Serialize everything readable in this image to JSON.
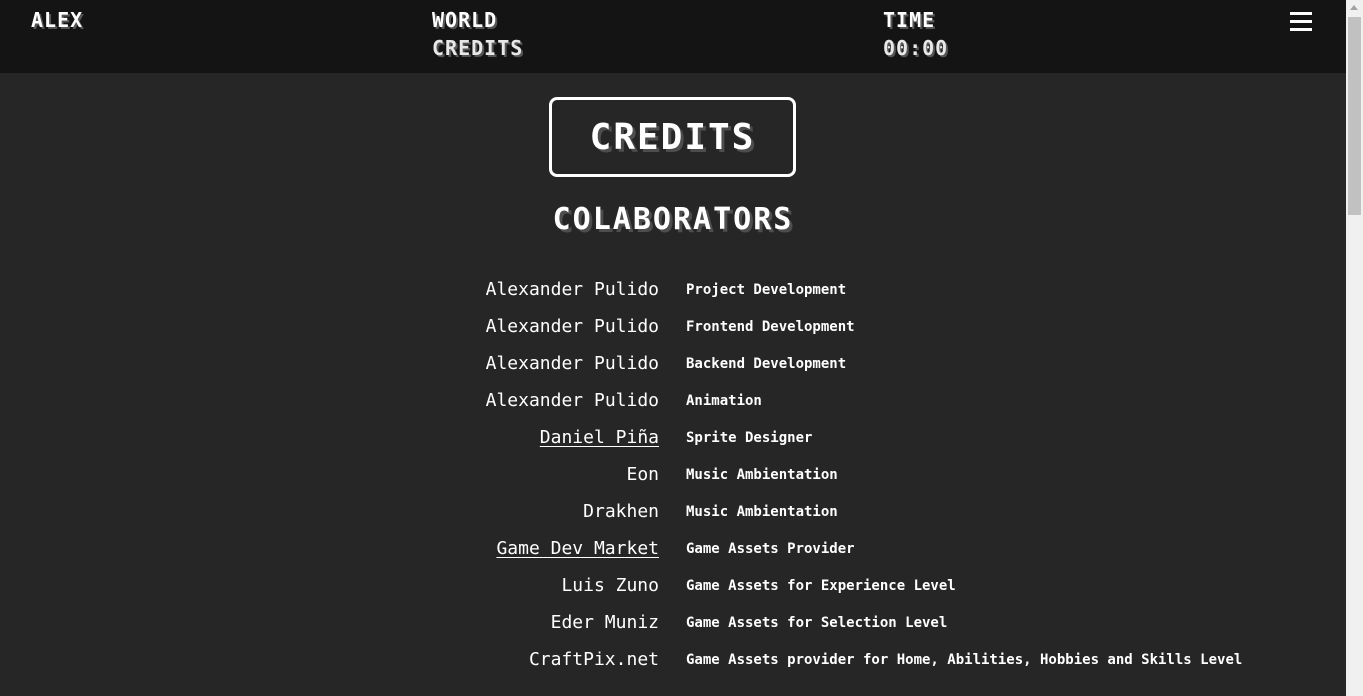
{
  "hud": {
    "player_name": "ALEX",
    "world_label": "WORLD",
    "world_value": "CREDITS",
    "time_label": "TIME",
    "time_value": "00:00",
    "menu_icon": "hamburger-menu-icon"
  },
  "page": {
    "title": "CREDITS",
    "section_heading": "COLABORATORS"
  },
  "credits": [
    {
      "name": "Alexander Pulido",
      "role": "Project Development",
      "link": false
    },
    {
      "name": "Alexander Pulido",
      "role": "Frontend Development",
      "link": false
    },
    {
      "name": "Alexander Pulido",
      "role": "Backend Development",
      "link": false
    },
    {
      "name": "Alexander Pulido",
      "role": "Animation",
      "link": false
    },
    {
      "name": "Daniel Piña",
      "role": "Sprite Designer",
      "link": true
    },
    {
      "name": "Eon",
      "role": "Music Ambientation",
      "link": false
    },
    {
      "name": "Drakhen",
      "role": "Music Ambientation",
      "link": false
    },
    {
      "name": "Game Dev Market",
      "role": "Game Assets Provider",
      "link": true
    },
    {
      "name": "Luis Zuno",
      "role": "Game Assets for Experience Level",
      "link": false
    },
    {
      "name": "Eder Muniz",
      "role": "Game Assets for Selection Level",
      "link": false
    },
    {
      "name": "CraftPix.net",
      "role": "Game Assets provider for Home, Abilities, Hobbies and Skills Level",
      "link": false
    }
  ],
  "colors": {
    "background": "#262626",
    "hud_background": "#141414",
    "text": "#ffffff"
  }
}
